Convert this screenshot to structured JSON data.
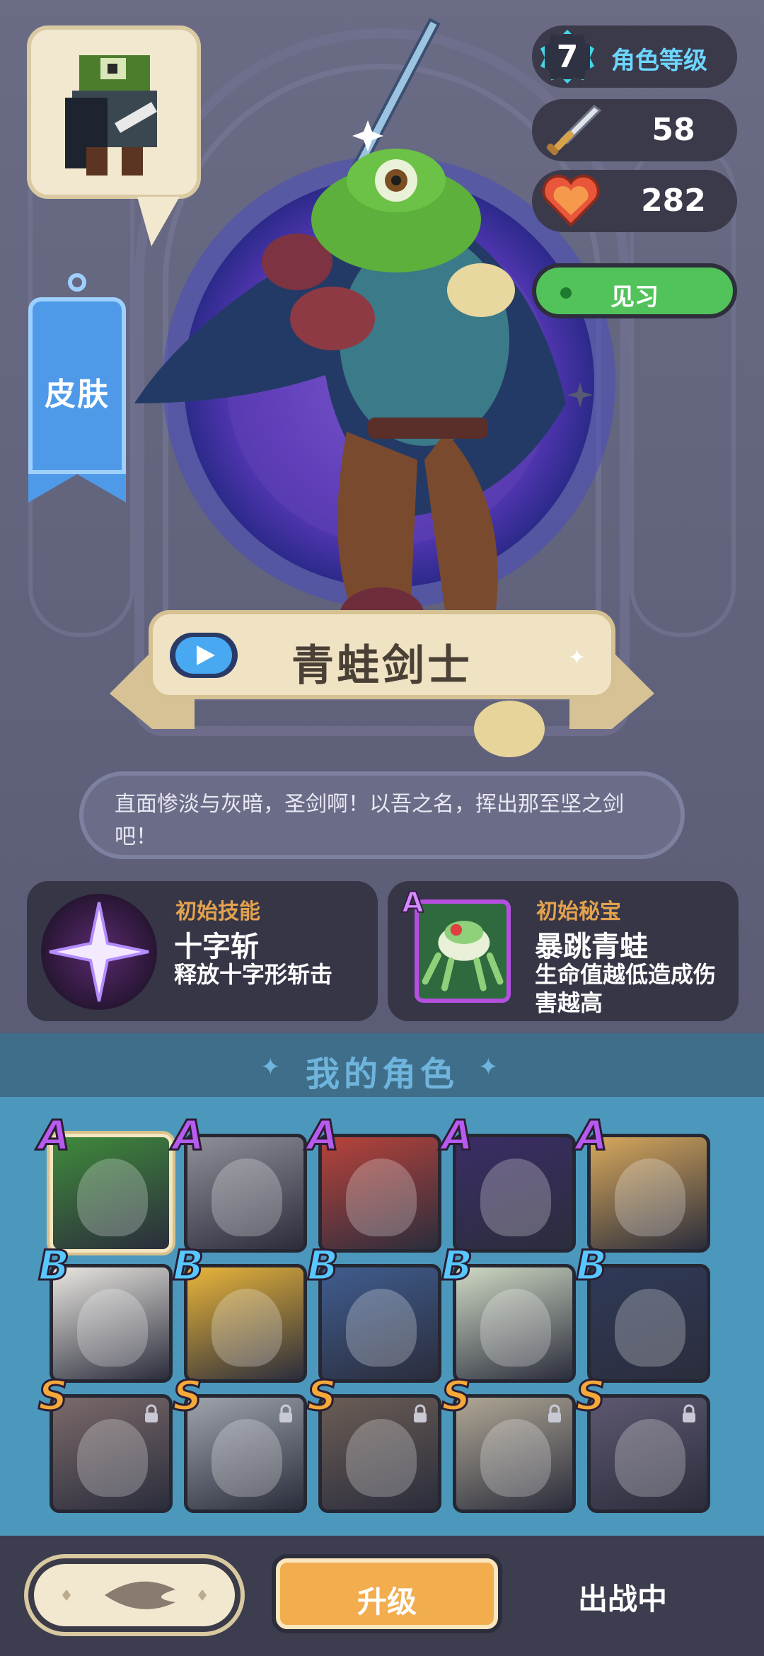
{
  "hero": {
    "name": "青蛙剑士",
    "quote": "直面惨淡与灰暗，圣剑啊！以吾之名，挥出那至坚之剑吧！",
    "skin_label": "皮肤"
  },
  "stats": {
    "level": "7",
    "level_label": "角色等级",
    "attack": "58",
    "hp": "282",
    "rank_label": "见习"
  },
  "abilities": {
    "skill": {
      "kind": "初始技能",
      "name": "十字斩",
      "desc": "释放十字形斩击"
    },
    "relic": {
      "kind": "初始秘宝",
      "grade": "A",
      "name": "暴跳青蛙",
      "desc": "生命值越低造成伤害越高"
    }
  },
  "roster": {
    "title": "我的角色",
    "rows": [
      {
        "grade": "A",
        "characters": [
          {
            "name": "frog-swordsman",
            "selected": true,
            "locked": false,
            "color": "#3f8a3c"
          },
          {
            "name": "armored-monster",
            "selected": false,
            "locked": false,
            "color": "#8f8f98"
          },
          {
            "name": "masked-rogue",
            "selected": false,
            "locked": false,
            "color": "#b8433b"
          },
          {
            "name": "dark-demon",
            "selected": false,
            "locked": false,
            "color": "#3b2d66"
          },
          {
            "name": "blonde-witch",
            "selected": false,
            "locked": false,
            "color": "#d7a85c"
          }
        ]
      },
      {
        "grade": "B",
        "characters": [
          {
            "name": "snowman",
            "selected": false,
            "locked": false,
            "color": "#e9e6e0"
          },
          {
            "name": "yellow-bird",
            "selected": false,
            "locked": false,
            "color": "#e9b53a"
          },
          {
            "name": "blue-hair-warrior",
            "selected": false,
            "locked": false,
            "color": "#3f5d8f"
          },
          {
            "name": "green-hair-girl",
            "selected": false,
            "locked": false,
            "color": "#cfd8c3"
          },
          {
            "name": "dark-knight",
            "selected": false,
            "locked": false,
            "color": "#2f3a58"
          }
        ]
      },
      {
        "grade": "S",
        "characters": [
          {
            "name": "dancer",
            "selected": false,
            "locked": true,
            "color": "#7b6a6a"
          },
          {
            "name": "silver-elf",
            "selected": false,
            "locked": true,
            "color": "#9ea3ac"
          },
          {
            "name": "dark-hair-girl",
            "selected": false,
            "locked": true,
            "color": "#6b5d55"
          },
          {
            "name": "white-hair-girl",
            "selected": false,
            "locked": true,
            "color": "#b0a795"
          },
          {
            "name": "joker",
            "selected": false,
            "locked": true,
            "color": "#5e5870"
          }
        ]
      }
    ]
  },
  "bottom": {
    "upgrade_label": "升级",
    "status_label": "出战中"
  },
  "colors": {
    "accent_blue": "#49a8f2",
    "rank_green": "#52c35b",
    "upgrade_orange": "#f2ad4f",
    "skill_orange": "#e3a24e"
  }
}
